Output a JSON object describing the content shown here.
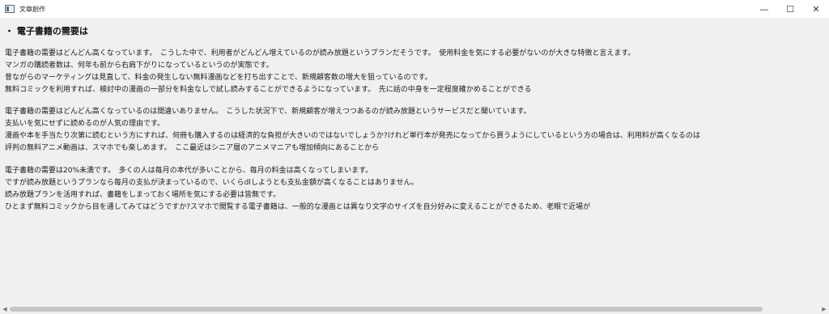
{
  "window": {
    "title": "文章創作",
    "controls": {
      "minimize": "—",
      "maximize": "☐",
      "close": "✕"
    }
  },
  "document": {
    "heading": "・ 電子書籍の需要は",
    "paragraphs": [
      [
        "電子書籍の需要はどんどん高くなっています。　こうした中で、利用者がどんどん増えているのが読み放題というプランだそうです。　使用料金を気にする必要がないのが大きな特徴と言えます。",
        "マンガの購読者数は、何年も前から右肩下がりになっているというのが実態です。",
        "昔ながらのマーケティングは見直して、料金の発生しない無料漫画などを打ち出すことで、新規顧客数の増大を狙っているのです。",
        "無料コミックを利用すれば、検討中の漫画の一部分を料金なしで試し読みすることができるようになっています。　先に話の中身を一定程度確かめることができる"
      ],
      [
        "電子書籍の需要はどんどん高くなっているのは間違いありません。　こうした状況下で、新規顧客が増えつつあるのが読み放題というサービスだと聞いています。",
        "支払いを気にせずに読めるのが人気の理由です。",
        "漫画や本を手当たり次第に読むという方にすれば、何冊も購入するのは経済的な負担が大きいのではないでしょうか?けれど単行本が発売になってから買うようにしているという方の場合は、利用料が高くなるのは",
        "評判の無料アニメ動画は、スマホでも楽しめます。　ここ最近はシニア層のアニメマニアも増加傾向にあることから"
      ],
      [
        "電子書籍の需要は20%未満です。　多くの人は毎月の本代が多いことから、毎月の料金は高くなってしまいます。",
        "ですが読み放題というプランなら毎月の支払が決まっているので、いくらdlしようとも支払金額が高くなることはありません。",
        "読み放題プランを活用すれば、書籍をしまっておく場所を気にする必要は皆無です。",
        "ひとまず無料コミックから目を通してみてはどうですか?スマホで閲覧する電子書籍は、一般的な漫画とは異なり文字のサイズを自分好みに変えることができるため、老眼で近場が"
      ]
    ]
  },
  "scrollbar": {
    "left_arrow": "◀",
    "right_arrow": "▶"
  },
  "colors": {
    "background": "#f0f0f0",
    "titlebar": "#ffffff",
    "text": "#1a1a1a",
    "thumb": "#c4c4c4"
  }
}
